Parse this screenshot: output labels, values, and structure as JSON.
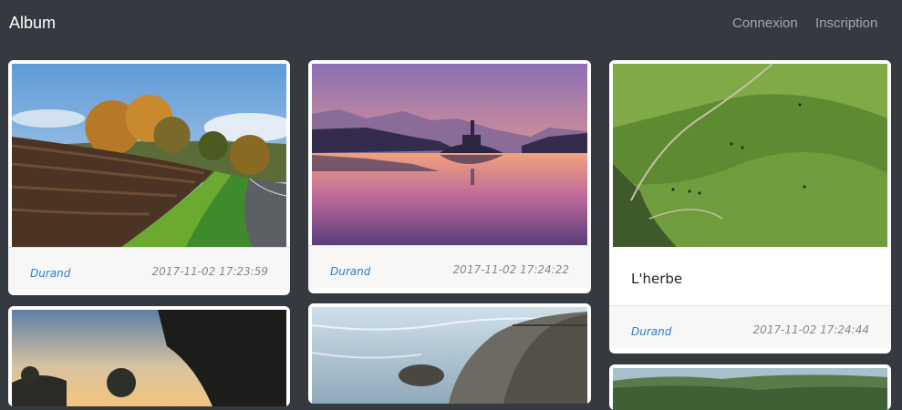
{
  "navbar": {
    "brand": "Album",
    "links": [
      "Connexion",
      "Inscription"
    ]
  },
  "cards": [
    {
      "author": "Durand",
      "date": "2017-11-02 17:23:59"
    },
    {
      "author": "Durand",
      "date": "2017-11-02 17:24:22"
    },
    {
      "title": "L'herbe",
      "author": "Durand",
      "date": "2017-11-02 17:24:44"
    }
  ],
  "colors": {
    "background": "#343a40",
    "author_link": "#2a7fc6",
    "card_footer": "#f7f7f7"
  }
}
